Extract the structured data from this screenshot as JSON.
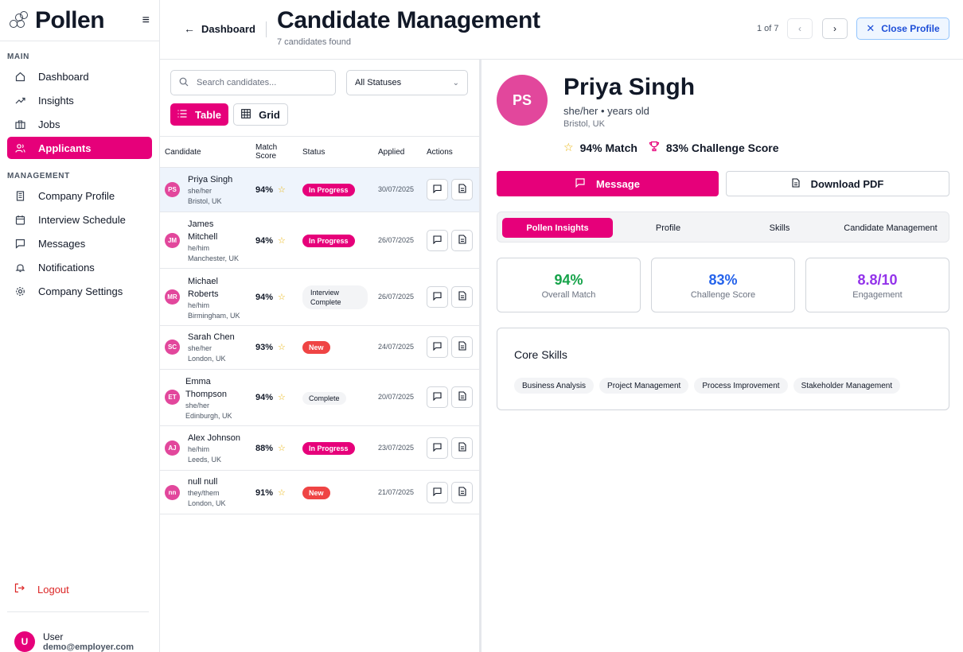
{
  "app": {
    "name": "Pollen",
    "sections": {
      "main": "MAIN",
      "management": "MANAGEMENT"
    },
    "nav_main": [
      {
        "label": "Dashboard",
        "icon": "home-icon",
        "active": false
      },
      {
        "label": "Insights",
        "icon": "trend-icon",
        "active": false
      },
      {
        "label": "Jobs",
        "icon": "briefcase-icon",
        "active": false
      },
      {
        "label": "Applicants",
        "icon": "users-icon",
        "active": true
      }
    ],
    "nav_management": [
      {
        "label": "Company Profile",
        "icon": "building-icon"
      },
      {
        "label": "Interview Schedule",
        "icon": "calendar-icon"
      },
      {
        "label": "Messages",
        "icon": "message-icon"
      },
      {
        "label": "Notifications",
        "icon": "bell-icon"
      },
      {
        "label": "Company Settings",
        "icon": "gear-icon"
      }
    ],
    "logout": "Logout",
    "user": {
      "initial": "U",
      "name": "User",
      "email": "demo@employer.com"
    }
  },
  "header": {
    "back": "Dashboard",
    "title": "Candidate Management",
    "subtitle": "7 candidates found",
    "pager": "1 of 7",
    "close": "Close Profile"
  },
  "list": {
    "search_placeholder": "Search candidates...",
    "status_filter": "All Statuses",
    "view_table": "Table",
    "view_grid": "Grid",
    "columns": {
      "candidate": "Candidate",
      "match": "Match Score",
      "status": "Status",
      "applied": "Applied",
      "actions": "Actions"
    },
    "rows": [
      {
        "initials": "PS",
        "name": "Priya Singh",
        "pronouns": "she/her",
        "location": "Bristol, UK",
        "score": "94%",
        "status": "In Progress",
        "applied": "30/07/2025"
      },
      {
        "initials": "JM",
        "name": "James Mitchell",
        "pronouns": "he/him",
        "location": "Manchester, UK",
        "score": "94%",
        "status": "In Progress",
        "applied": "26/07/2025"
      },
      {
        "initials": "MR",
        "name": "Michael Roberts",
        "pronouns": "he/him",
        "location": "Birmingham, UK",
        "score": "94%",
        "status": "Interview Complete",
        "applied": "26/07/2025"
      },
      {
        "initials": "SC",
        "name": "Sarah Chen",
        "pronouns": "she/her",
        "location": "London, UK",
        "score": "93%",
        "status": "New",
        "applied": "24/07/2025"
      },
      {
        "initials": "ET",
        "name": "Emma Thompson",
        "pronouns": "she/her",
        "location": "Edinburgh, UK",
        "score": "94%",
        "status": "Complete",
        "applied": "20/07/2025"
      },
      {
        "initials": "AJ",
        "name": "Alex Johnson",
        "pronouns": "he/him",
        "location": "Leeds, UK",
        "score": "88%",
        "status": "In Progress",
        "applied": "23/07/2025"
      },
      {
        "initials": "nn",
        "name": "null null",
        "pronouns": "they/them",
        "location": "London, UK",
        "score": "91%",
        "status": "New",
        "applied": "21/07/2025"
      }
    ]
  },
  "detail": {
    "initials": "PS",
    "name": "Priya Singh",
    "pronouns_age": "she/her • years old",
    "location": "Bristol, UK",
    "match": "94% Match",
    "challenge": "83% Challenge Score",
    "message_btn": "Message",
    "pdf_btn": "Download PDF",
    "tabs": [
      "Pollen Insights",
      "Profile",
      "Skills",
      "Candidate Management"
    ],
    "stats": [
      {
        "value": "94%",
        "label": "Overall Match",
        "color": "#16a34a"
      },
      {
        "value": "83%",
        "label": "Challenge Score",
        "color": "#2563eb"
      },
      {
        "value": "8.8/10",
        "label": "Engagement",
        "color": "#9333ea"
      }
    ],
    "skills_title": "Core Skills",
    "skills": [
      "Business Analysis",
      "Project Management",
      "Process Improvement",
      "Stakeholder Management"
    ]
  },
  "colors": {
    "accent": "#e6007a",
    "new_badge": "#ef4444",
    "selected_row": "#eef4fc"
  }
}
